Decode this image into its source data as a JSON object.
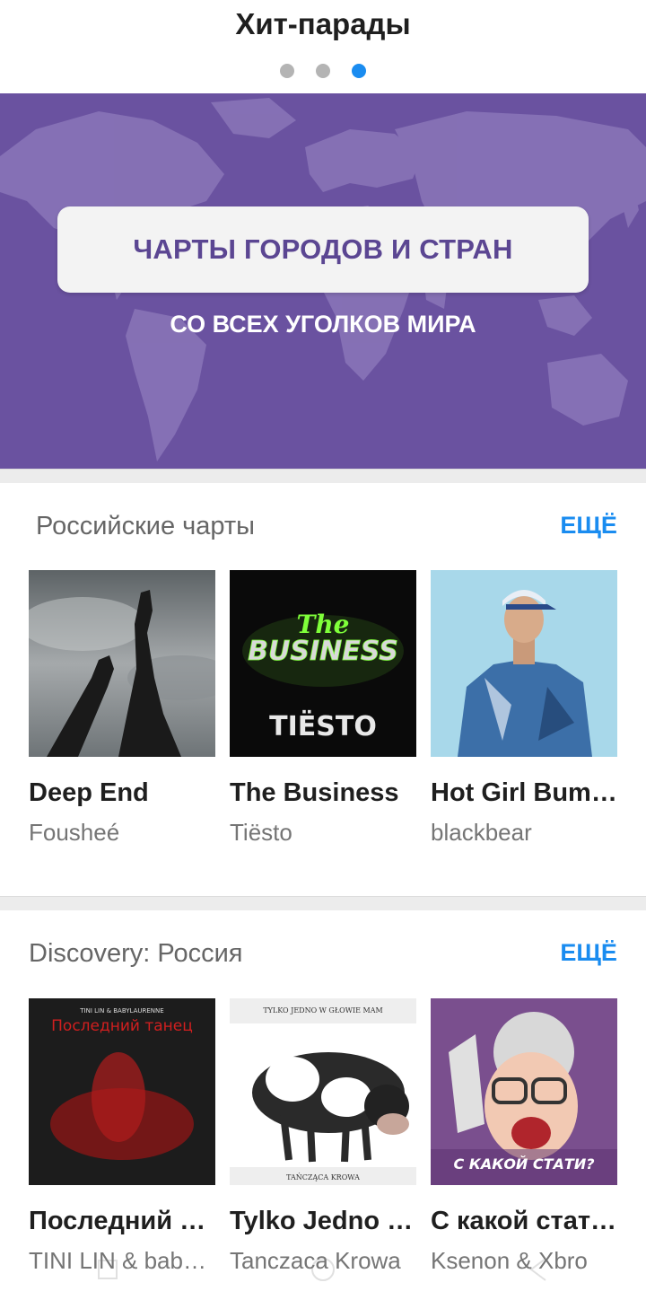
{
  "header": {
    "title": "Хит-парады",
    "pages": 3,
    "active_page": 3
  },
  "banner": {
    "button_label": "ЧАРТЫ ГОРОДОВ И СТРАН",
    "subtitle": "СО ВСЕХ УГОЛКОВ МИРА",
    "background_color": "#6a52a0"
  },
  "sections": [
    {
      "title": "Российские чарты",
      "more_label": "ЕЩЁ",
      "items": [
        {
          "title": "Deep End",
          "artist": "Fousheé",
          "cover": "legs-in-sky-cover"
        },
        {
          "title": "The Business",
          "artist": "Tiësto",
          "cover": "the-business-cover",
          "cover_text_1": "The",
          "cover_text_2": "BUSINESS",
          "cover_text_3": "TIËSTO"
        },
        {
          "title": "Hot Girl Bummer",
          "artist": "blackbear",
          "cover": "man-portrait-cover"
        }
      ]
    },
    {
      "title": "Discovery: Россия",
      "more_label": "ЕЩЁ",
      "items": [
        {
          "title": "Последний танец",
          "artist": "TINI LIN & babylaurenne",
          "cover": "last-dance-cover",
          "cover_text_1": "TINI LIN & BABYLAURENNE",
          "cover_text_2": "Последний танец"
        },
        {
          "title": "Tylko Jedno w Głowie Mam",
          "artist": "Tanczaca Krowa",
          "cover": "cow-cover",
          "cover_text_1": "TYLKO JEDNO W GŁOWIE MAM",
          "cover_text_2": "TAŃCZĄCA KROWA"
        },
        {
          "title": "С какой стати?",
          "artist": "Ksenon & Xbro",
          "cover": "cartoon-grandma-cover",
          "cover_text_1": "С КАКОЙ СТАТИ?"
        }
      ]
    }
  ],
  "colors": {
    "accent": "#1a8cf0",
    "banner": "#6a52a0",
    "banner_text": "#5b4692"
  }
}
